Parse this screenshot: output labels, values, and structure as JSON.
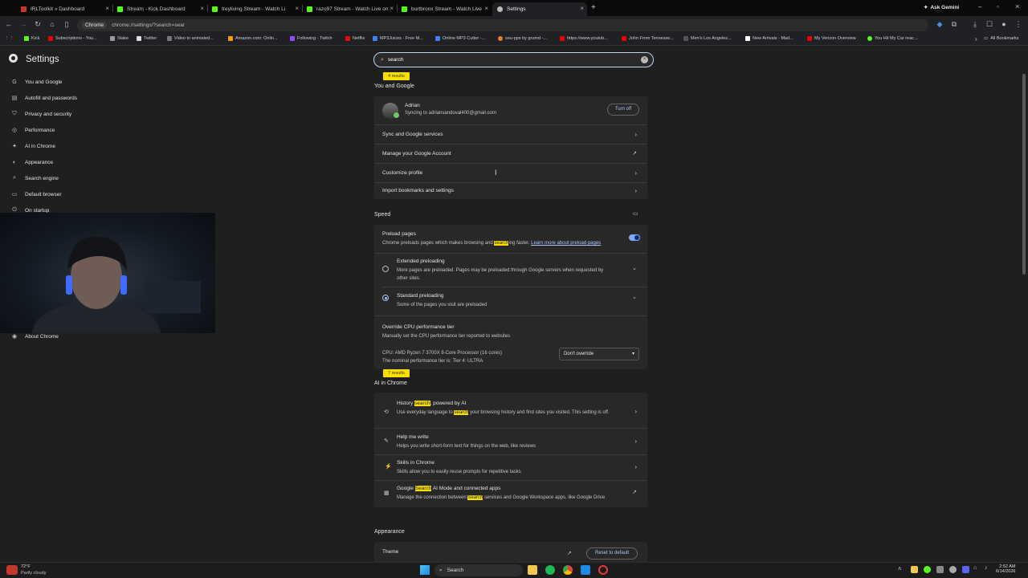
{
  "tabs": [
    {
      "label": "IRLToolkit » Dashboard",
      "color": "#c0392b"
    },
    {
      "label": "Stream - Kick Dashboard",
      "color": "#53fc18"
    },
    {
      "label": "treyliving Stream - Watch Li",
      "color": "#53fc18"
    },
    {
      "label": "razo97 Stream - Watch Live on",
      "color": "#53fc18"
    },
    {
      "label": "burtbronx Stream - Watch Live",
      "color": "#53fc18"
    },
    {
      "label": "Settings",
      "color": "#bbbbbb"
    }
  ],
  "ask_gemini": "Ask Gemini",
  "omnibox": {
    "chip": "Chrome",
    "url": "chrome://settings/?search=sear"
  },
  "bookmarks": [
    "Kick",
    "Subscriptions - You...",
    "Stake",
    "Twitter",
    "Video to animated...",
    "Amazon.com: Onlin...",
    "Following - Twitch",
    "Netflix",
    "MP3Juices - Free M...",
    "Online MP3 Cutter -...",
    "osu-pps by grumd -...",
    "https://www.youtub...",
    "John From Tennesse...",
    "Men's Los Angeles...",
    "New Arrivals - Mad...",
    "My Verizon Overview",
    "You Hit My Car reac..."
  ],
  "all_bookmarks": "All Bookmarks",
  "settings_title": "Settings",
  "nav": [
    {
      "label": "You and Google",
      "icon": "G"
    },
    {
      "label": "Autofill and passwords",
      "icon": "▤"
    },
    {
      "label": "Privacy and security",
      "icon": "⛉"
    },
    {
      "label": "Performance",
      "icon": "◎"
    },
    {
      "label": "AI in Chrome",
      "icon": "✦"
    },
    {
      "label": "Appearance",
      "icon": "◐"
    },
    {
      "label": "Search engine",
      "icon": "⌕"
    },
    {
      "label": "Default browser",
      "icon": "▭"
    },
    {
      "label": "On startup",
      "icon": "⏻"
    }
  ],
  "nav_about": "About Chrome",
  "search_value": "search",
  "you_google": {
    "results": "4 results",
    "title": "You and Google",
    "name": "Adrian",
    "email": "Syncing to adriansandoval400@gmail.com",
    "turn_off": "Turn off",
    "rows": [
      "Sync and Google services",
      "Manage your Google Account",
      "Customize profile",
      "Import bookmarks and settings"
    ]
  },
  "speed": {
    "title": "Speed",
    "preload_title": "Preload pages",
    "preload_desc_a": "Chrome preloads pages which makes browsing and ",
    "preload_desc_hl": "search",
    "preload_desc_b": "ing faster.",
    "preload_link": "Learn more about preload pages",
    "ext_title": "Extended preloading",
    "ext_desc": "More pages are preloaded. Pages may be preloaded through Google servers when requested by other sites.",
    "std_title": "Standard preloading",
    "std_desc": "Some of the pages you visit are preloaded",
    "cpu_title": "Override CPU performance tier",
    "cpu_desc": "Manually set the CPU performance tier reported to websites",
    "cpu_line1": "CPU: AMD Ryzen 7 3700X 8-Core Processor (16 cores)",
    "cpu_line2": "The nominal performance tier is: Tier 4: ULTRA",
    "dropdown": "Don't override"
  },
  "ai": {
    "results": "7 results",
    "title": "AI in Chrome",
    "history_a": "History ",
    "history_hl": "search",
    "history_b": ", powered by AI",
    "history_desc_a": "Use everyday language to ",
    "history_desc_hl": "search",
    "history_desc_b": " your browsing history and find sites you visited. This setting is off.",
    "help_title": "Help me write",
    "help_desc": "Helps you write short-form text for things on the web, like reviews",
    "skills_title": "Skills in Chrome",
    "skills_desc": "Skills allow you to easily reuse prompts for repetitive tasks",
    "gs_a": "Google ",
    "gs_hl": "Search",
    "gs_b": " AI Mode and connected apps",
    "gs_desc_a": "Manage the connection between ",
    "gs_desc_hl": "Search",
    "gs_desc_b": " services and Google Workspace apps, like Google Drive"
  },
  "appearance": {
    "title": "Appearance",
    "theme": "Theme",
    "reset": "Reset to default"
  },
  "taskbar": {
    "weather_temp": "72°F",
    "weather_desc": "Partly cloudy",
    "search": "Search",
    "time": "2:52 AM",
    "date": "6/14/2026"
  }
}
